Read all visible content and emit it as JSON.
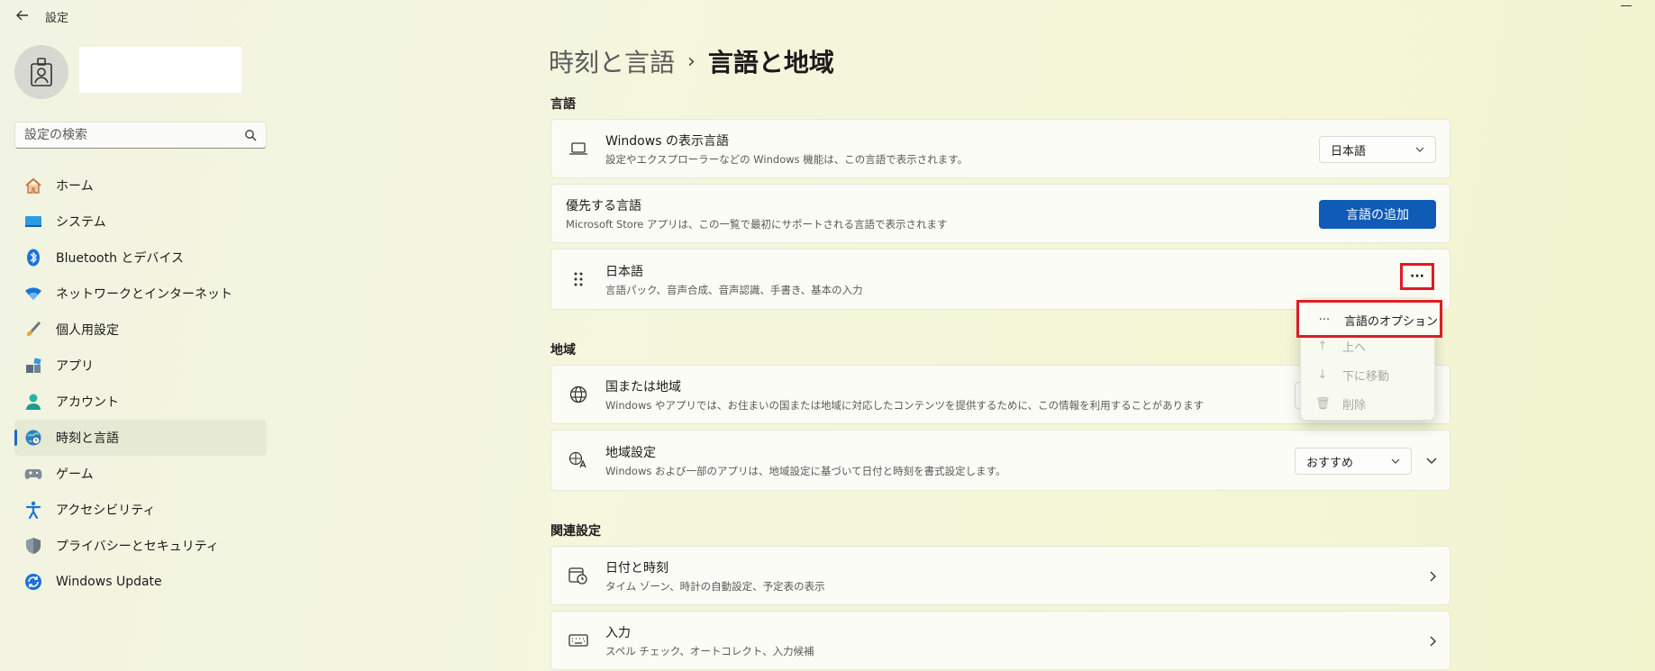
{
  "window": {
    "title": "設定"
  },
  "search": {
    "placeholder": "設定の検索"
  },
  "nav": [
    {
      "label": "ホーム",
      "icon": "home-icon"
    },
    {
      "label": "システム",
      "icon": "system-icon"
    },
    {
      "label": "Bluetooth とデバイス",
      "icon": "bluetooth-icon"
    },
    {
      "label": "ネットワークとインターネット",
      "icon": "wifi-icon"
    },
    {
      "label": "個人用設定",
      "icon": "brush-icon"
    },
    {
      "label": "アプリ",
      "icon": "apps-icon"
    },
    {
      "label": "アカウント",
      "icon": "account-icon"
    },
    {
      "label": "時刻と言語",
      "icon": "time-language-icon",
      "selected": true
    },
    {
      "label": "ゲーム",
      "icon": "gamepad-icon"
    },
    {
      "label": "アクセシビリティ",
      "icon": "accessibility-icon"
    },
    {
      "label": "プライバシーとセキュリティ",
      "icon": "shield-icon"
    },
    {
      "label": "Windows Update",
      "icon": "update-icon"
    }
  ],
  "header": {
    "parent": "時刻と言語",
    "separator": "›",
    "current": "言語と地域"
  },
  "language": {
    "section_title": "言語",
    "display_language": {
      "title": "Windows の表示言語",
      "description": "設定やエクスプローラーなどの Windows 機能は、この言語で表示されます。",
      "value": "日本語"
    },
    "preferred": {
      "title": "優先する言語",
      "description": "Microsoft Store アプリは、この一覧で最初にサポートされる言語で表示されます",
      "button": "言語の追加"
    },
    "japanese": {
      "title": "日本語",
      "description": "言語パック、音声合成、音声認識、手書き、基本の入力",
      "more": "···"
    }
  },
  "context_menu": {
    "items": [
      {
        "label": "言語のオプション",
        "icon": "more-icon",
        "enabled": true
      },
      {
        "label": "上へ",
        "icon": "arrow-up-icon",
        "enabled": false
      },
      {
        "label": "下に移動",
        "icon": "arrow-down-icon",
        "enabled": false
      },
      {
        "label": "削除",
        "icon": "trash-icon",
        "enabled": false
      }
    ]
  },
  "region": {
    "section_title": "地域",
    "country": {
      "title": "国または地域",
      "description": "Windows やアプリでは、お住まいの国または地域に対応したコンテンツを提供するために、この情報を利用することがあります"
    },
    "format": {
      "title": "地域設定",
      "description": "Windows および一部のアプリは、地域設定に基づいて日付と時刻を書式設定します。",
      "value": "おすすめ"
    }
  },
  "related": {
    "section_title": "関連設定",
    "items": [
      {
        "title": "日付と時刻",
        "description": "タイム ゾーン、時計の自動設定、予定表の表示"
      },
      {
        "title": "入力",
        "description": "スペル チェック、オートコレクト、入力候補"
      }
    ]
  },
  "colors": {
    "accent": "#0f5bb5",
    "highlight": "#e01b24"
  }
}
